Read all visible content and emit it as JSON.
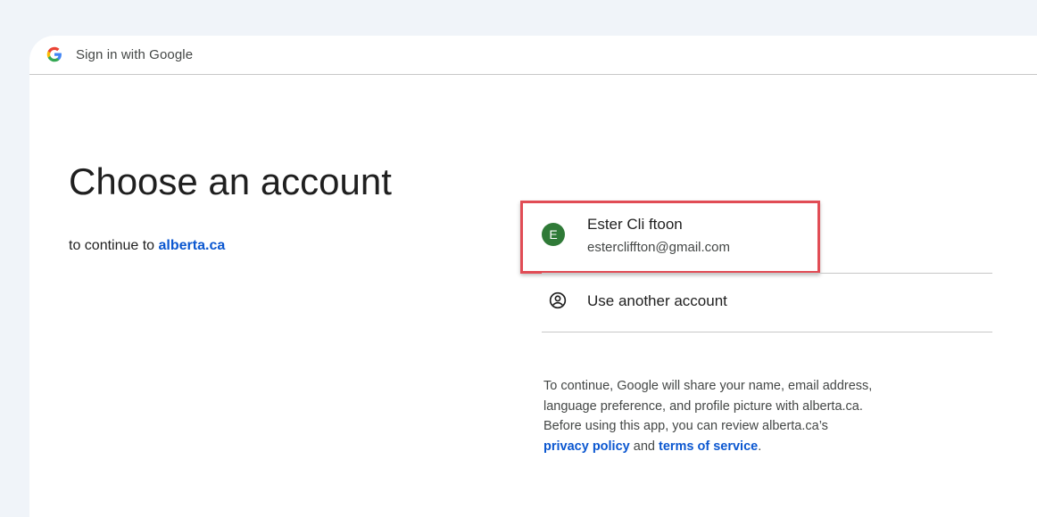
{
  "header": {
    "logo_icon": "google-g-icon",
    "title": "Sign in with Google"
  },
  "main": {
    "title": "Choose an account",
    "subtitle_prefix": "to continue to",
    "subtitle_link": "alberta.ca"
  },
  "accounts": [
    {
      "avatar_letter": "E",
      "avatar_color": "#2f7a37",
      "name": "Ester Cli ftoon",
      "email": "estercliffton@gmail.com"
    }
  ],
  "use_another": {
    "icon": "person-circle-icon",
    "label": "Use another account"
  },
  "disclaimer": {
    "line1": "To continue, Google will share your name, email address,",
    "line2": "language preference, and profile picture with alberta.ca.",
    "line3": "Before using this app, you can review alberta.ca’s",
    "privacy_link": "privacy policy",
    "and_text": "and",
    "terms_link": "terms of service",
    "period": "."
  },
  "colors": {
    "link": "#0b57d0",
    "highlight": "#e14c55",
    "page_bg": "#f0f4f9"
  }
}
